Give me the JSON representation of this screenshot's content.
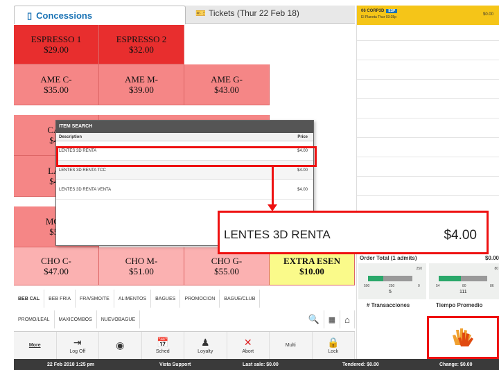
{
  "tabs": {
    "concessions": "Concessions",
    "tickets": "Tickets (Thur 22 Feb 18)"
  },
  "tiles": [
    {
      "name": "ESPRESSO 1",
      "price": "$29.00"
    },
    {
      "name": "ESPRESSO 2",
      "price": "$32.00"
    },
    {
      "name": "AME C-",
      "price": "$35.00"
    },
    {
      "name": "AME M-",
      "price": "$39.00"
    },
    {
      "name": "AME G-",
      "price": "$43.00"
    },
    {
      "name": "CAP",
      "price": "$46"
    },
    {
      "name": "LAT",
      "price": "$46"
    },
    {
      "name": "MOK",
      "price": "$51"
    },
    {
      "name": "CHO C-",
      "price": "$47.00"
    },
    {
      "name": "CHO M-",
      "price": "$51.00"
    },
    {
      "name": "CHO G-",
      "price": "$55.00"
    },
    {
      "name": "EXTRA ESEN",
      "price": "$10.00"
    }
  ],
  "categories1": [
    "BEB CAL",
    "BEB FRIA",
    "FRA/SMO/TE",
    "ALIMENTOS",
    "BAGUES",
    "PROMOCION",
    "BAGUE/CLUB"
  ],
  "categories2": [
    "PROMO/LEAL",
    "MAXICOMBOS",
    "NUEVOBAGUE"
  ],
  "toolbar": [
    "More",
    "Log Off",
    "",
    "Sched",
    "Loyalty",
    "Abort",
    "Multi",
    "Lock"
  ],
  "status": {
    "date": "22 Feb 2018 1:25 pm",
    "support": "Vista Support",
    "last": "Last sale: $0.00",
    "tendered": "Tendered: $0.00",
    "change": "Change: $0.00"
  },
  "order": {
    "line1": "06 CORP3D",
    "line2": "El Planeta Thur 03:35p",
    "badge": "ESP",
    "price": "$0.00",
    "total_label": "Order Total (1 admits)",
    "total": "$0.00"
  },
  "gauges": [
    {
      "title": "# Transacciones",
      "marker": "250",
      "min": "500",
      "mid": "250",
      "max": "0",
      "value": "5",
      "level": 0.35
    },
    {
      "title": "Tiempo Promedio",
      "marker": "80",
      "min": "54",
      "mid": "80",
      "max": "86",
      "value": "111",
      "level": 0.45
    }
  ],
  "dialog": {
    "title": "ITEM SEARCH",
    "col_desc": "Description",
    "col_price": "Price",
    "rows": [
      {
        "desc": "LENTES 3D RENTA",
        "price": "$4.00"
      },
      {
        "desc": "LENTES 3D RENTA TCC",
        "price": "$4.00"
      },
      {
        "desc": "LENTES 3D RENTA VENTA",
        "price": "$4.00"
      }
    ]
  },
  "zoom": {
    "desc": "LENTES 3D RENTA",
    "price": "$4.00"
  },
  "colors": {
    "accent": "#e11111",
    "brand": "#1a73b5",
    "order_header": "#f5c518"
  }
}
